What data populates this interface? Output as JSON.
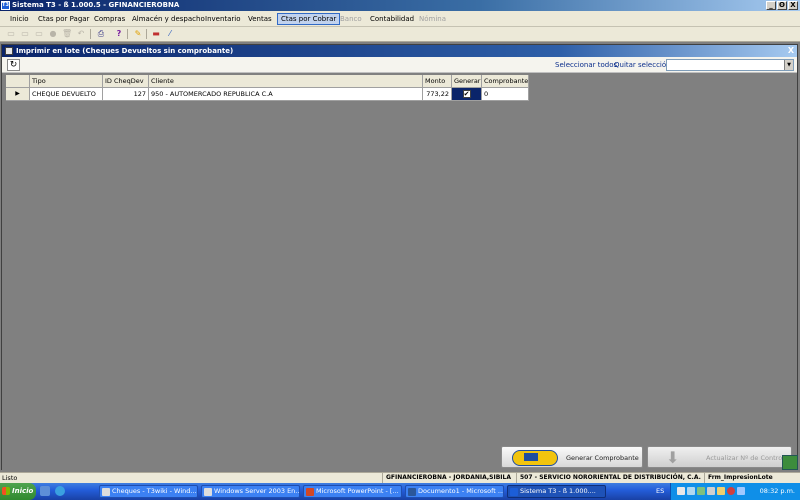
{
  "app": {
    "title": "Sistema T3 - ß 1.000.5 - GFINANCIEROBNA",
    "window_buttons": [
      "_",
      "ʘ",
      "X"
    ]
  },
  "menu": [
    {
      "label": "Inicio",
      "state": "normal"
    },
    {
      "label": "Ctas por Pagar",
      "state": "normal"
    },
    {
      "label": "Compras",
      "state": "normal"
    },
    {
      "label": "Almacén y despacho",
      "state": "normal"
    },
    {
      "label": "Inventario",
      "state": "normal"
    },
    {
      "label": "Ventas",
      "state": "normal"
    },
    {
      "label": "Ctas por Cobrar",
      "state": "active"
    },
    {
      "label": "Banco",
      "state": "disabled"
    },
    {
      "label": "Contabilidad",
      "state": "normal"
    },
    {
      "label": "Nómina",
      "state": "disabled"
    }
  ],
  "toolbar_icons": [
    "new-icon",
    "open-icon",
    "save-icon",
    "record-icon",
    "delete-icon",
    "undo-icon",
    "print-icon",
    "help-icon",
    "pencil-icon",
    "minus-icon",
    "wand-icon"
  ],
  "child": {
    "title": "Imprimir en lote (Cheques Devueltos sin comprobante)",
    "close": "X",
    "select_all": "Seleccionar todos",
    "clear_selection": "Quitar selección",
    "lote_value": "",
    "refresh_glyph": "↻"
  },
  "grid": {
    "columns": [
      "Tipo",
      "ID CheqDev",
      "Cliente",
      "Monto",
      "Generar",
      "Comprobante"
    ],
    "rows": [
      {
        "indicator": "▶",
        "tipo": "CHEQUE DEVUELTO",
        "id": "127",
        "cliente": "950 - AUTOMERCADO REPUBLICA C.A",
        "monto": "773,22",
        "generar": "✔",
        "comprobante": "0"
      }
    ]
  },
  "buttons": {
    "generate": "Generar Comprobante",
    "update": "Actualizar Nº de Control"
  },
  "status": {
    "text": "Listo",
    "panel1": "GFINANCIEROBNA - JORDANIA,SIBILA",
    "panel2": "507 - SERVICIO NORORIENTAL DE DISTRIBUCIÓN, C.A.",
    "panel3": "Frm_ImpresionLote"
  },
  "taskbar": {
    "start": "Inicio",
    "tasks": [
      {
        "label": "Cheques - T3wiki - Wind...",
        "active": false
      },
      {
        "label": "Windows Server 2003 En...",
        "active": false
      },
      {
        "label": "Microsoft PowerPoint - [...",
        "active": false
      },
      {
        "label": "Documento1 - Microsoft ...",
        "active": false
      },
      {
        "label": "Sistema T3 - ß 1.000....",
        "active": true
      }
    ],
    "lang": "ES",
    "clock": "08:32 p.m."
  }
}
